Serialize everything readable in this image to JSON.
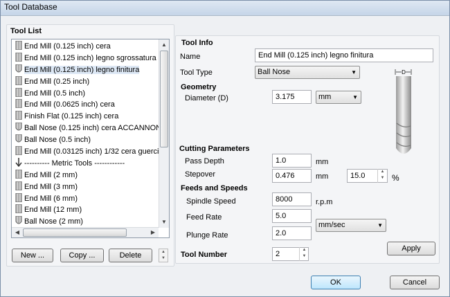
{
  "window": {
    "title": "Tool Database"
  },
  "tool_list": {
    "heading": "Tool List",
    "items": [
      {
        "label": "End Mill (0.125 inch) cera",
        "icon": "end-mill-icon"
      },
      {
        "label": "End Mill (0.125 inch) legno sgrossatura",
        "icon": "end-mill-icon"
      },
      {
        "label": "End Mill (0.125 inch) legno finitura",
        "icon": "ball-nose-icon",
        "selected": true
      },
      {
        "label": "End Mill (0.25 inch)",
        "icon": "end-mill-icon"
      },
      {
        "label": "End Mill (0.5 inch)",
        "icon": "end-mill-icon"
      },
      {
        "label": "End Mill (0.0625 inch) cera",
        "icon": "end-mill-icon"
      },
      {
        "label": "Finish Flat (0.125 inch) cera",
        "icon": "end-mill-icon"
      },
      {
        "label": "Ball Nose (0.125 inch) cera ACCANNON",
        "icon": "ball-nose-icon"
      },
      {
        "label": "Ball Nose (0.5 inch)",
        "icon": "ball-nose-icon"
      },
      {
        "label": "End Mill (0.03125 inch) 1/32 cera guerci",
        "icon": "end-mill-icon"
      },
      {
        "label": "---------- Metric Tools ------------",
        "icon": "group-arrow-icon"
      },
      {
        "label": "End Mill (2 mm)",
        "icon": "end-mill-icon"
      },
      {
        "label": "End Mill (3 mm)",
        "icon": "end-mill-icon"
      },
      {
        "label": "End Mill (6 mm)",
        "icon": "end-mill-icon"
      },
      {
        "label": "End Mill (12 mm)",
        "icon": "end-mill-icon"
      },
      {
        "label": "Ball Nose (2 mm)",
        "icon": "ball-nose-icon"
      }
    ],
    "buttons": {
      "new": "New ...",
      "copy": "Copy ...",
      "delete": "Delete"
    }
  },
  "tool_info": {
    "heading": "Tool Info",
    "name_label": "Name",
    "name_value": "End Mill (0.125 inch) legno finitura",
    "type_label": "Tool Type",
    "type_value": "Ball Nose",
    "diagram_label": "D"
  },
  "geometry": {
    "heading": "Geometry",
    "diameter_label": "Diameter (D)",
    "diameter_value": "3.175",
    "units_value": "mm"
  },
  "cutting": {
    "heading": "Cutting Parameters",
    "pass_depth_label": "Pass Depth",
    "pass_depth_value": "1.0",
    "pass_depth_unit": "mm",
    "stepover_label": "Stepover",
    "stepover_value": "0.476",
    "stepover_unit": "mm",
    "stepover_percent": "15.0",
    "percent_sign": "%"
  },
  "feeds": {
    "heading": "Feeds and Speeds",
    "spindle_label": "Spindle Speed",
    "spindle_value": "8000",
    "spindle_unit": "r.p.m",
    "feed_label": "Feed Rate",
    "feed_value": "5.0",
    "plunge_label": "Plunge Rate",
    "plunge_value": "2.0",
    "rate_units": "mm/sec"
  },
  "tool_number": {
    "label": "Tool Number",
    "value": "2"
  },
  "actions": {
    "apply": "Apply",
    "ok": "OK",
    "cancel": "Cancel"
  }
}
